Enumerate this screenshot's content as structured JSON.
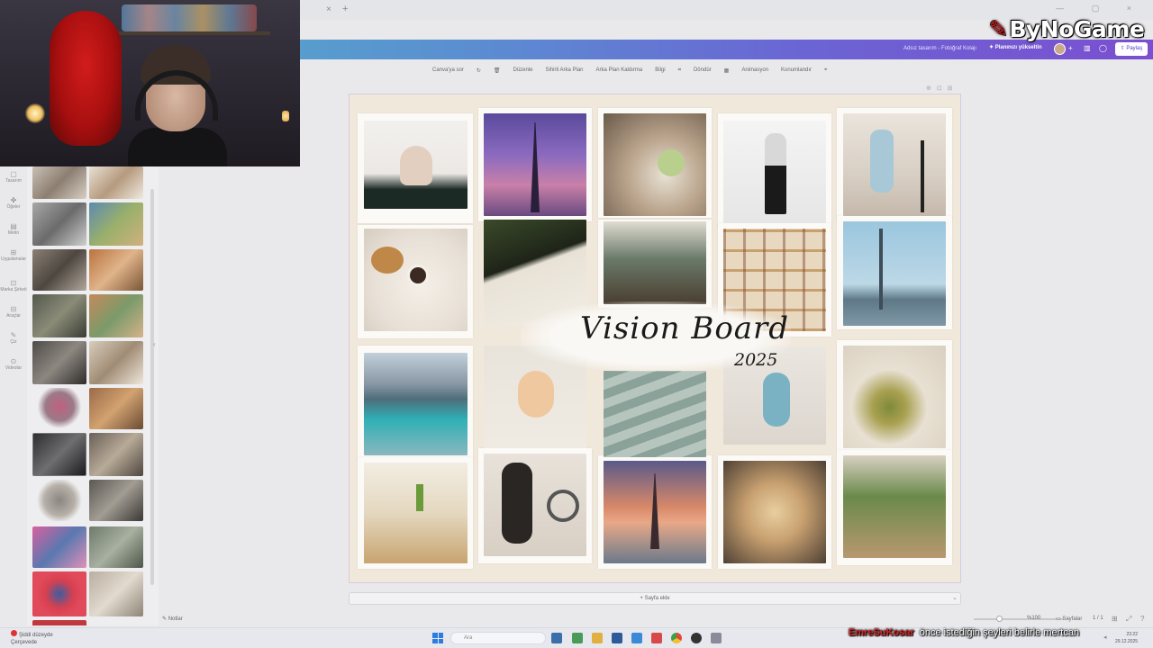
{
  "browser": {
    "tab_close": "×",
    "new_tab": "+",
    "window_controls": "— ▢ ×"
  },
  "header": {
    "doc_title": "Adsız tasarım - Fotoğraf Kolajı",
    "upgrade_label": "✦ Planınızı yükseltin",
    "share_label": "⇧ Paylaş"
  },
  "toolbar": {
    "items": [
      "Canva'ya sor",
      "Düzenle",
      "Sihirli Arka Plan",
      "Arka Plan Kaldırma",
      "Bilgi",
      "Döndür",
      "Animasyon",
      "Konumlandır"
    ]
  },
  "left_rail": {
    "items": [
      {
        "icon": "▢",
        "label": "Tasarım"
      },
      {
        "icon": "✤",
        "label": "Öğeler"
      },
      {
        "icon": "▤",
        "label": "Metin"
      },
      {
        "icon": "⊞",
        "label": "Uygulamalar"
      },
      {
        "icon": "⊡",
        "label": "Marka Şirketi"
      },
      {
        "icon": "⊟",
        "label": "Araçlar"
      },
      {
        "icon": "✎",
        "label": "Çiz"
      },
      {
        "icon": "⊙",
        "label": "Videolar"
      }
    ]
  },
  "brand": {
    "logo_text": "ByNoGame"
  },
  "canvas": {
    "title": "Vision Board",
    "year": "2025",
    "add_page_label": "+ Sayfa ekle"
  },
  "status_bar": {
    "notes_label": "Notlar",
    "zoom": "%100",
    "pages_label": "Sayfalar",
    "page_count": "1 / 1"
  },
  "taskbar": {
    "weather_temp": "Şiddi düzeyde",
    "weather_desc": "Çerçevede",
    "search_placeholder": "Ara",
    "time": "23:22",
    "date": "29.12.2025"
  },
  "subtitle": {
    "user": "EmreSuKosar",
    "text": "önce istediğin şeyleri belirle mertcan"
  },
  "colors": {
    "header_gradient_start": "#53b7c6",
    "header_gradient_end": "#7b4fd0",
    "page_background": "#f1e8dc",
    "brand_red": "#d82020"
  }
}
